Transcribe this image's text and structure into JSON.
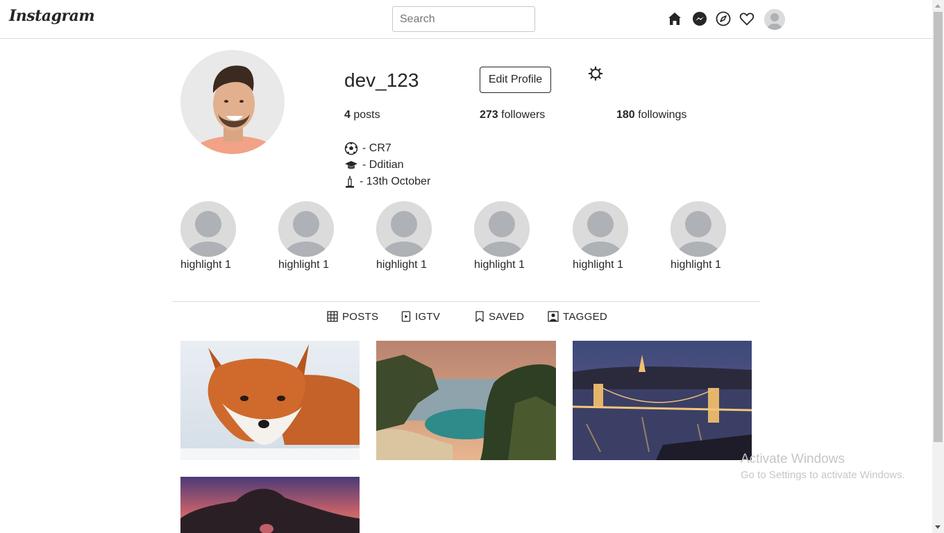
{
  "header": {
    "logo": "Instagram",
    "search_placeholder": "Search",
    "nav_icons": [
      "home-icon",
      "messenger-icon",
      "explore-icon",
      "heart-icon",
      "avatar"
    ]
  },
  "profile": {
    "username": "dev_123",
    "edit_label": "Edit Profile",
    "stats": {
      "posts_count": "4",
      "posts_label": "posts",
      "followers_count": "273",
      "followers_label": "followers",
      "following_count": "180",
      "following_label": "followings"
    },
    "bio": [
      {
        "icon": "soccer-ball-icon",
        "text": "- CR7"
      },
      {
        "icon": "graduation-cap-icon",
        "text": "- Dditian"
      },
      {
        "icon": "candle-icon",
        "text": "- 13th October"
      }
    ]
  },
  "highlights": [
    {
      "label": "highlight 1"
    },
    {
      "label": "highlight 1"
    },
    {
      "label": "highlight 1"
    },
    {
      "label": "highlight 1"
    },
    {
      "label": "highlight 1"
    },
    {
      "label": "highlight 1"
    }
  ],
  "tabs": [
    {
      "label": "POSTS",
      "icon": "grid-icon"
    },
    {
      "label": "IGTV",
      "icon": "igtv-icon"
    },
    {
      "label": "SAVED",
      "icon": "bookmark-icon"
    },
    {
      "label": "TAGGED",
      "icon": "tagged-icon"
    }
  ],
  "posts": [
    "fox",
    "coastal-cove",
    "bridge-at-night",
    "rock-arch-sunset"
  ],
  "watermark": {
    "title": "Activate Windows",
    "subtitle": "Go to Settings to activate Windows."
  }
}
